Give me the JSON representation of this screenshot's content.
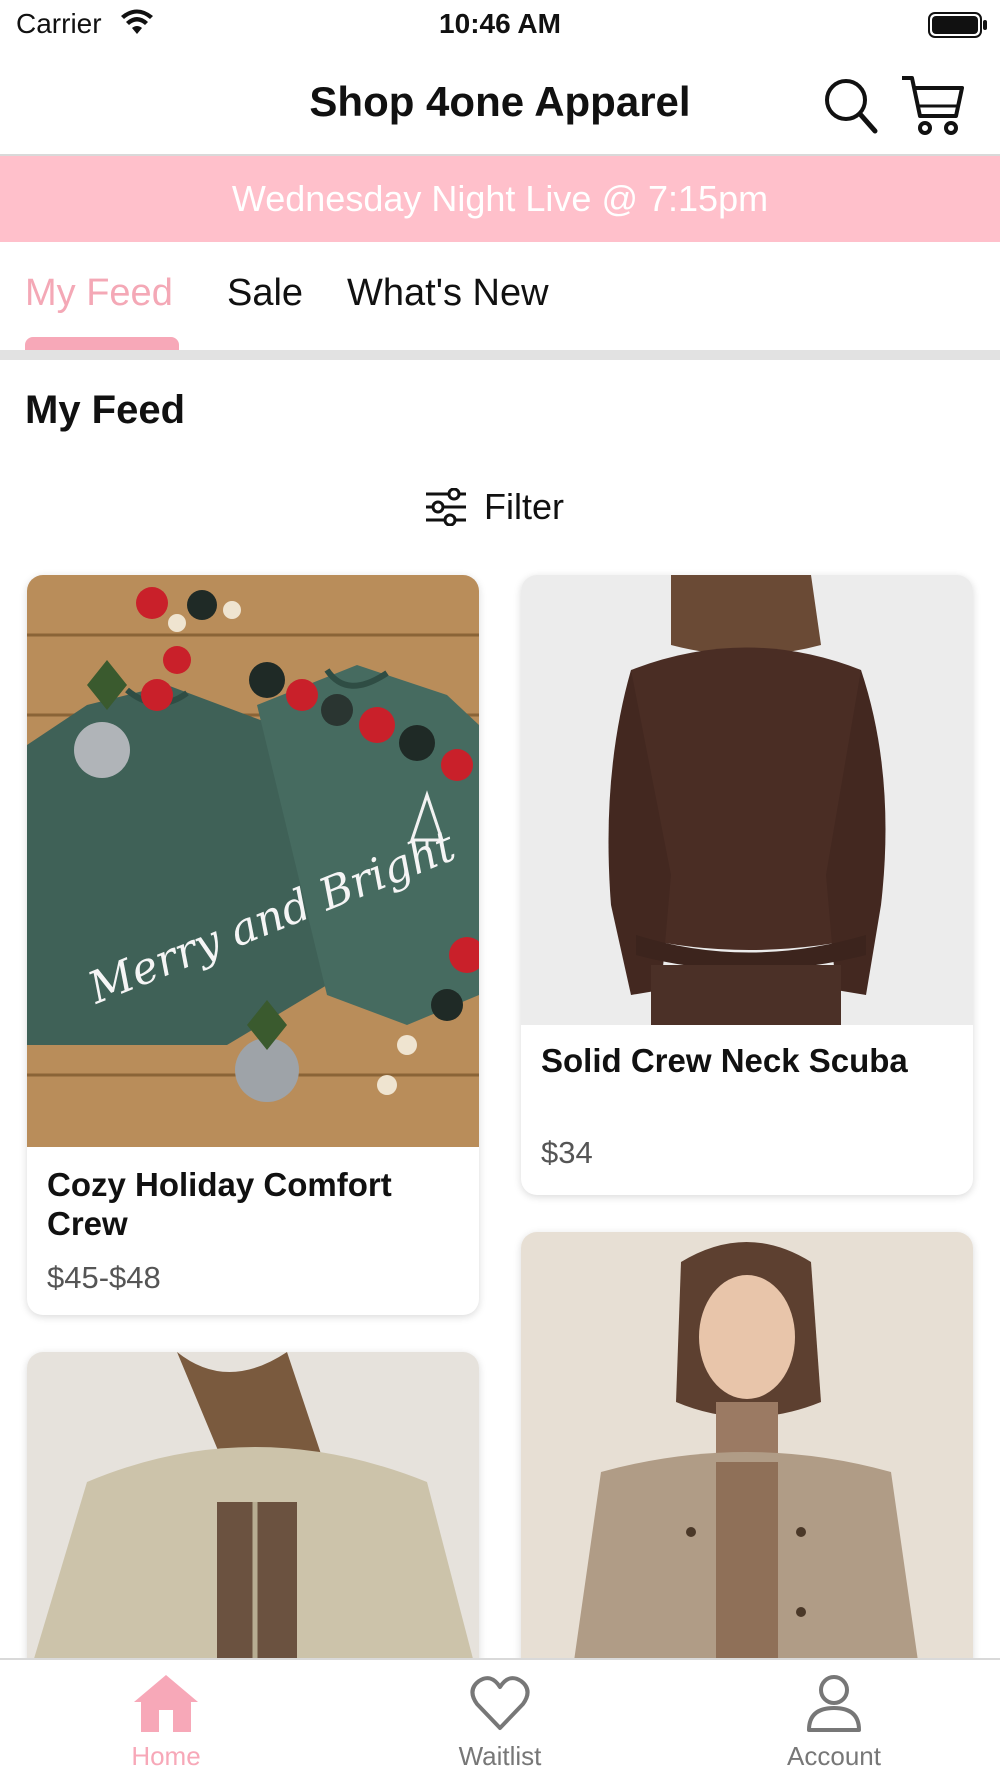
{
  "status_bar": {
    "carrier": "Carrier",
    "time": "10:46 AM"
  },
  "header": {
    "title": "Shop 4one Apparel",
    "icons": [
      "search-icon",
      "cart-icon"
    ]
  },
  "banner": {
    "text": "Wednesday Night Live @ 7:15pm"
  },
  "tabs": [
    {
      "label": "My Feed",
      "active": true
    },
    {
      "label": "Sale",
      "active": false
    },
    {
      "label": "What's New",
      "active": false
    }
  ],
  "section": {
    "title": "My Feed",
    "filter_label": "Filter"
  },
  "products": [
    {
      "name": "Cozy Holiday Comfort Crew",
      "price": "$45-$48",
      "print": "Merry and Bright"
    },
    {
      "name": "Solid Crew Neck Scuba",
      "price": "$34"
    }
  ],
  "bottom_nav": [
    {
      "label": "Home",
      "icon": "home-icon",
      "active": true
    },
    {
      "label": "Waitlist",
      "icon": "heart-icon",
      "active": false
    },
    {
      "label": "Account",
      "icon": "account-icon",
      "active": false
    }
  ],
  "colors": {
    "accent": "#f7a8b8",
    "banner_bg": "#ffc0cb",
    "inactive": "#777777"
  }
}
